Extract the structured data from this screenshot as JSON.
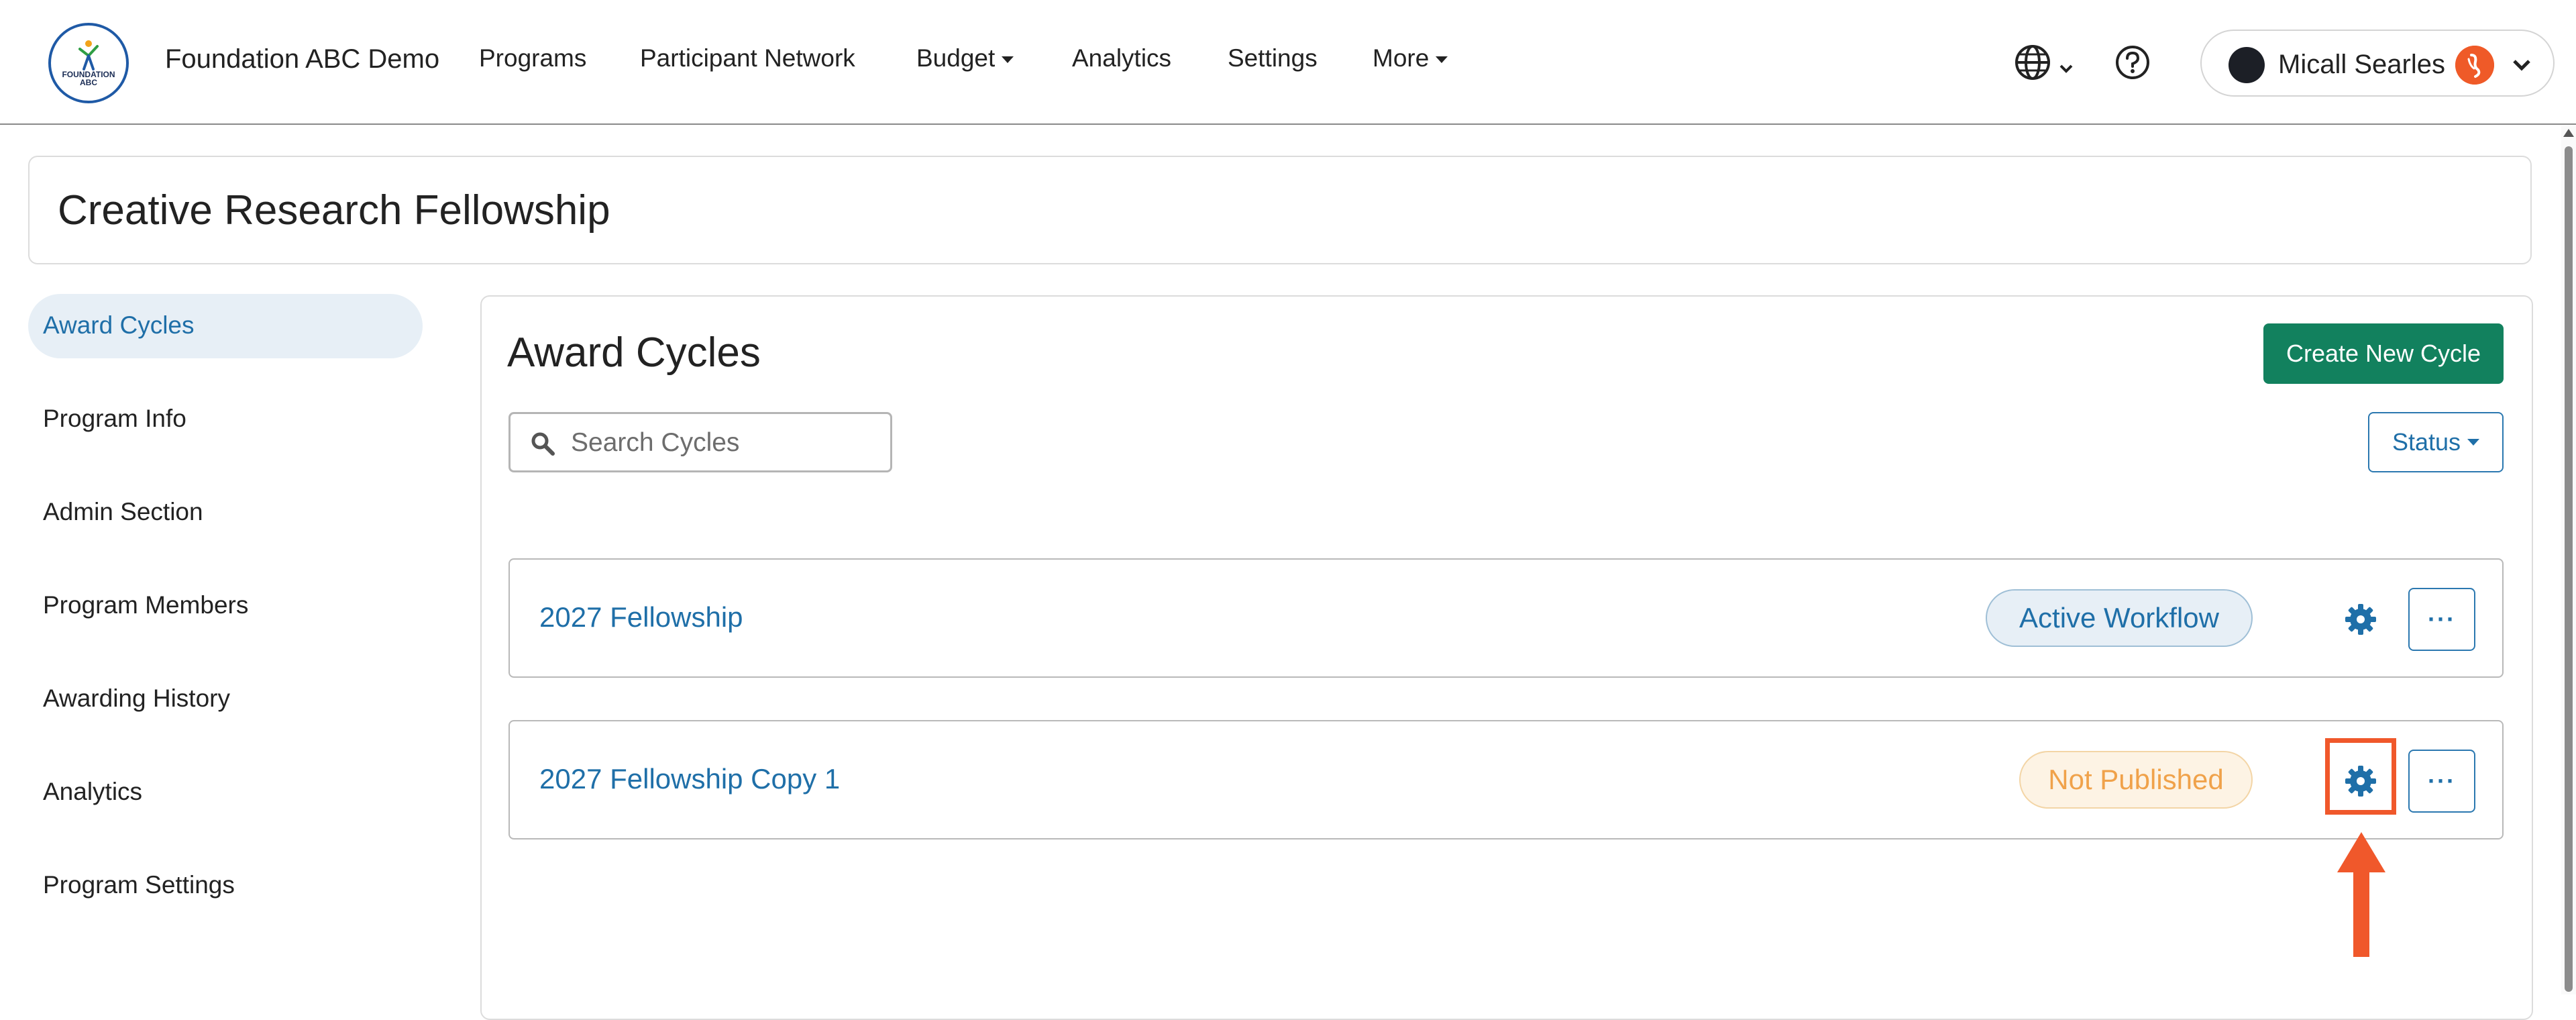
{
  "navbar": {
    "logo_text_line1": "FOUNDATION",
    "logo_text_line2": "ABC",
    "brand": "Foundation ABC Demo",
    "items": [
      {
        "label": "Programs"
      },
      {
        "label": "Participant Network"
      },
      {
        "label": "Budget"
      },
      {
        "label": "Analytics"
      },
      {
        "label": "Settings"
      },
      {
        "label": "More"
      }
    ],
    "icons": [
      "globe-icon",
      "help-icon"
    ],
    "user": {
      "name": "Micall Searles",
      "badge_color": "#ef5a28"
    }
  },
  "page": {
    "title": "Creative Research Fellowship"
  },
  "sidebar": {
    "items": [
      {
        "label": "Award Cycles",
        "active": true
      },
      {
        "label": "Program Info"
      },
      {
        "label": "Admin Section"
      },
      {
        "label": "Program Members"
      },
      {
        "label": "Awarding History"
      },
      {
        "label": "Analytics"
      },
      {
        "label": "Program Settings"
      }
    ]
  },
  "main": {
    "title": "Award Cycles",
    "create_button": "Create New Cycle",
    "search_placeholder": "Search Cycles",
    "search_value": "",
    "status_filter": "Status",
    "cycles": [
      {
        "name": "2027 Fellowship",
        "status": "Active Workflow",
        "more_label": "···"
      },
      {
        "name": "2027 Fellowship Copy 1",
        "status": "Not Published",
        "more_label": "···"
      }
    ]
  },
  "colors": {
    "accent": "#1f6fa8",
    "primary_button": "#12815e",
    "highlight": "#f0582b",
    "active_pill_bg": "#e7eff6",
    "unpublished_pill_bg": "#fdf3e4"
  }
}
